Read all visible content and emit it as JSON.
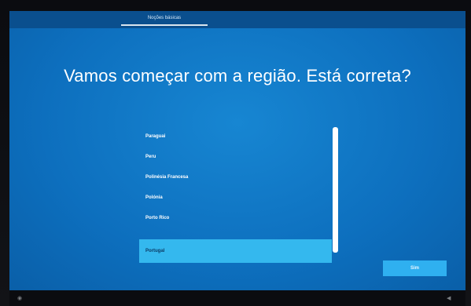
{
  "topbar": {
    "tab_label": "Noções básicas"
  },
  "page": {
    "title": "Vamos começar com a região. Está correta?"
  },
  "region_list": {
    "items": [
      {
        "label": "Paraguai"
      },
      {
        "label": "Peru"
      },
      {
        "label": "Polinésia Francesa"
      },
      {
        "label": "Polónia"
      },
      {
        "label": "Porto Rico"
      },
      {
        "label": "Portugal",
        "selected": true
      }
    ]
  },
  "buttons": {
    "next_label": "Sim"
  },
  "icons": {
    "bottom_left": "accessibility-icon",
    "bottom_right": "speaker-icon"
  },
  "colors": {
    "background": "#0d6fbe",
    "selected": "#34b8ee",
    "button": "#2fb0f0"
  }
}
